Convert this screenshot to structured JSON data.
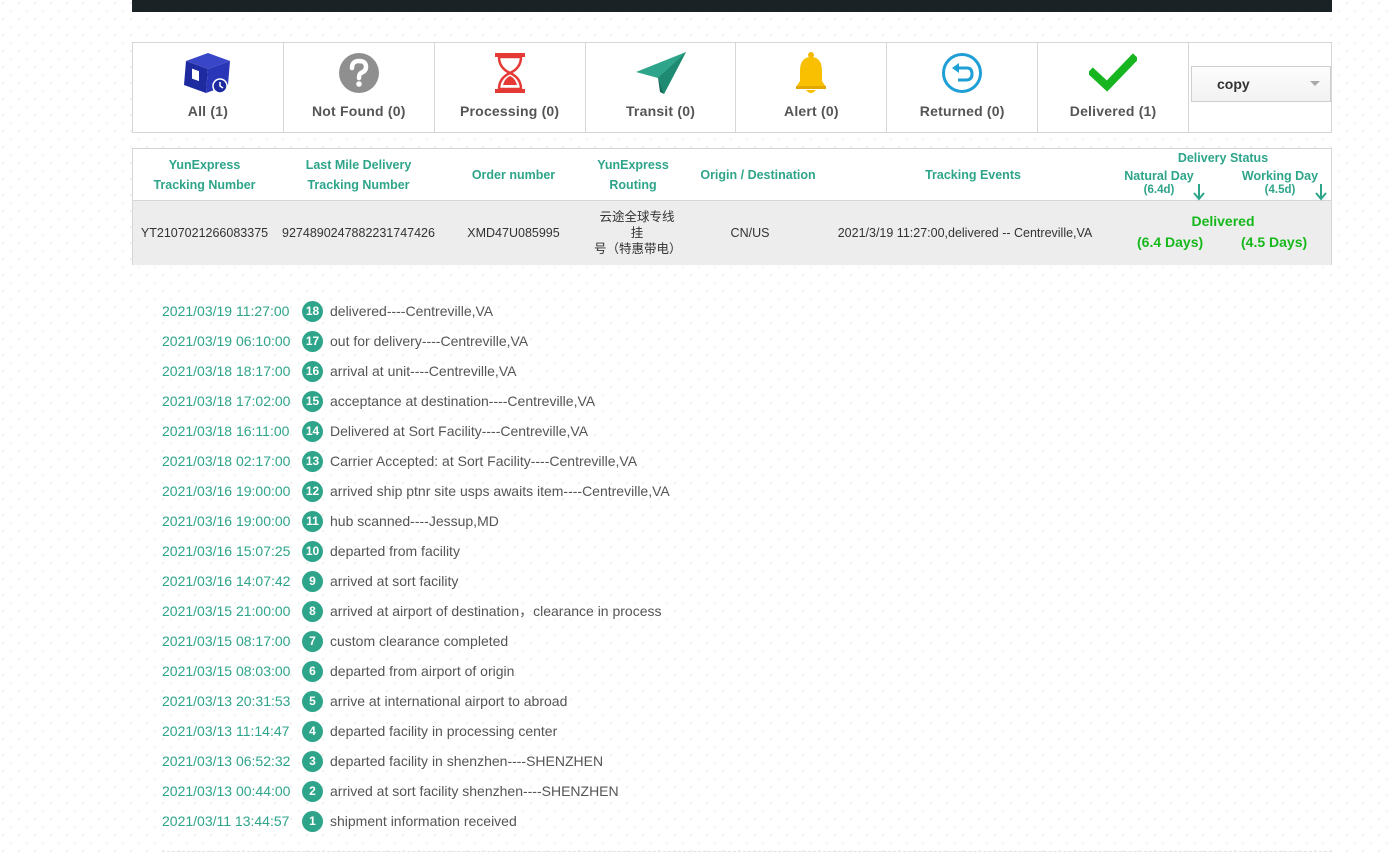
{
  "filters": [
    {
      "label": "All (1)",
      "icon": "package-icon"
    },
    {
      "label": "Not Found (0)",
      "icon": "question-icon"
    },
    {
      "label": "Processing (0)",
      "icon": "hourglass-icon"
    },
    {
      "label": "Transit (0)",
      "icon": "paper-plane-icon"
    },
    {
      "label": "Alert (0)",
      "icon": "bell-icon"
    },
    {
      "label": "Returned (0)",
      "icon": "return-icon"
    },
    {
      "label": "Delivered (1)",
      "icon": "checkmark-icon"
    }
  ],
  "copy_select": {
    "value": "copy"
  },
  "summary": {
    "headers": {
      "tracking_l1": "YunExpress",
      "tracking_l2": "Tracking Number",
      "lastmile_l1": "Last Mile Delivery",
      "lastmile_l2": "Tracking Number",
      "order": "Order number",
      "routing_l1": "YunExpress",
      "routing_l2": "Routing",
      "origin": "Origin / Destination",
      "events": "Tracking Events",
      "status": "Delivery Status",
      "natural": "Natural Day",
      "natural_val": "(6.4d)",
      "working": "Working Day",
      "working_val": "(4.5d)"
    },
    "row": {
      "tracking": "YT2107021266083375",
      "lastmile": "9274890247882231747426",
      "order": "XMD47U085995",
      "routing_l1": "云途全球专线挂",
      "routing_l2": "号（特惠带电）",
      "origin": "CN/US",
      "event": "2021/3/19 11:27:00,delivered -- Centreville,VA",
      "status": "Delivered",
      "natural_days": "(6.4 Days)",
      "working_days": "(4.5 Days)"
    }
  },
  "events": [
    {
      "time": "2021/03/19 11:27:00",
      "num": "18",
      "desc": "delivered----Centreville,VA"
    },
    {
      "time": "2021/03/19 06:10:00",
      "num": "17",
      "desc": "out for delivery----Centreville,VA"
    },
    {
      "time": "2021/03/18 18:17:00",
      "num": "16",
      "desc": "arrival at unit----Centreville,VA"
    },
    {
      "time": "2021/03/18 17:02:00",
      "num": "15",
      "desc": "acceptance at destination----Centreville,VA"
    },
    {
      "time": "2021/03/18 16:11:00",
      "num": "14",
      "desc": "Delivered at Sort Facility----Centreville,VA"
    },
    {
      "time": "2021/03/18 02:17:00",
      "num": "13",
      "desc": "Carrier Accepted: at Sort Facility----Centreville,VA"
    },
    {
      "time": "2021/03/16 19:00:00",
      "num": "12",
      "desc": "arrived ship ptnr site usps awaits item----Centreville,VA"
    },
    {
      "time": "2021/03/16 19:00:00",
      "num": "11",
      "desc": "hub scanned----Jessup,MD"
    },
    {
      "time": "2021/03/16 15:07:25",
      "num": "10",
      "desc": "departed from facility"
    },
    {
      "time": "2021/03/16 14:07:42",
      "num": "9",
      "desc": "arrived at sort facility"
    },
    {
      "time": "2021/03/15 21:00:00",
      "num": "8",
      "desc": "arrived at airport of destination，clearance in process"
    },
    {
      "time": "2021/03/15 08:17:00",
      "num": "7",
      "desc": "custom clearance completed"
    },
    {
      "time": "2021/03/15 08:03:00",
      "num": "6",
      "desc": "departed from airport of origin"
    },
    {
      "time": "2021/03/13 20:31:53",
      "num": "5",
      "desc": "arrive at international airport to abroad"
    },
    {
      "time": "2021/03/13 11:14:47",
      "num": "4",
      "desc": "departed facility in processing center"
    },
    {
      "time": "2021/03/13 06:52:32",
      "num": "3",
      "desc": "departed facility in shenzhen----SHENZHEN"
    },
    {
      "time": "2021/03/13 00:44:00",
      "num": "2",
      "desc": "arrived at sort facility shenzhen----SHENZHEN"
    },
    {
      "time": "2021/03/11 13:44:57",
      "num": "1",
      "desc": "shipment information received"
    }
  ],
  "colors": {
    "accent": "#2ea58a",
    "delivered": "#16b81c",
    "topbar": "#1b2225"
  }
}
